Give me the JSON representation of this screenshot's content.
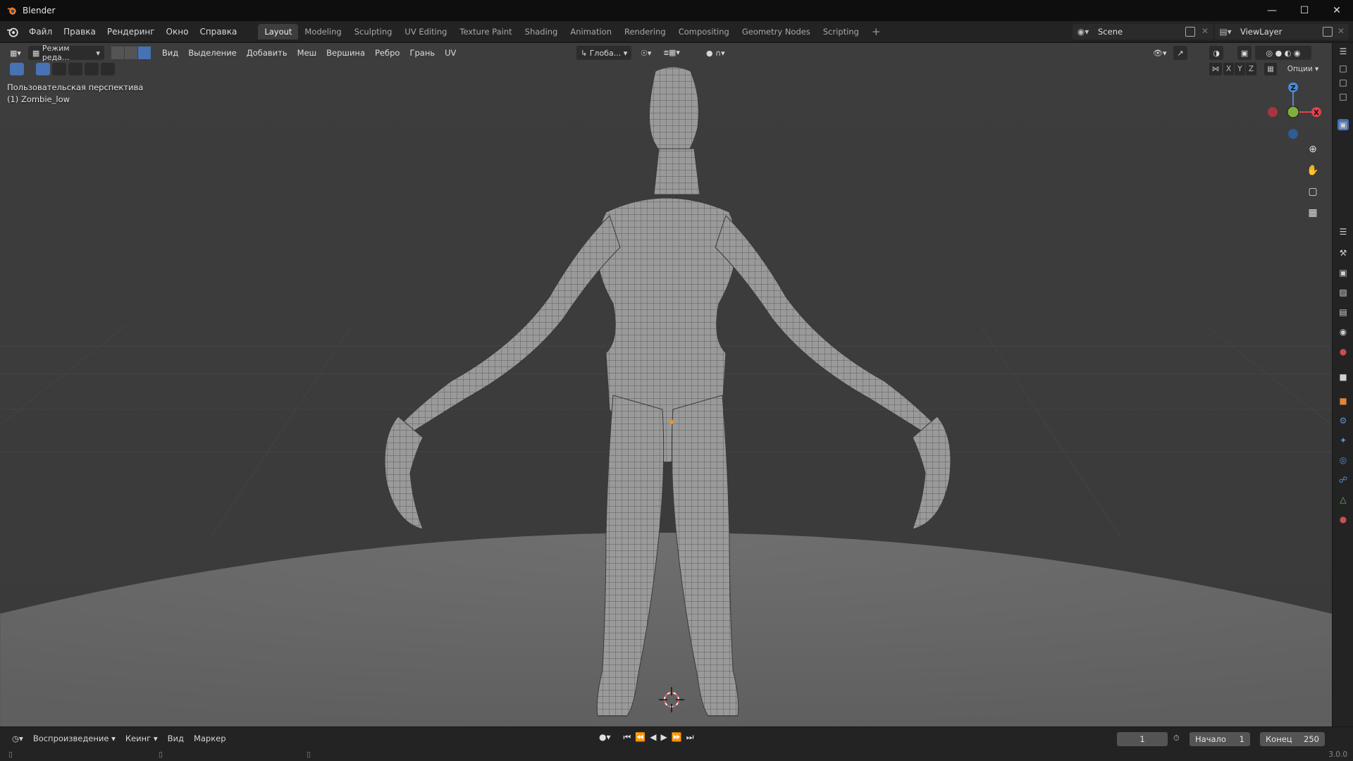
{
  "window": {
    "title": "Blender"
  },
  "menu": {
    "items": [
      "Файл",
      "Правка",
      "Рендеринг",
      "Окно",
      "Справка"
    ]
  },
  "workspaces": {
    "tabs": [
      "Layout",
      "Modeling",
      "Sculpting",
      "UV Editing",
      "Texture Paint",
      "Shading",
      "Animation",
      "Rendering",
      "Compositing",
      "Geometry Nodes",
      "Scripting"
    ],
    "active": "Layout",
    "add": "+"
  },
  "scene": {
    "name": "Scene"
  },
  "view_layer": {
    "name": "ViewLayer"
  },
  "viewport_header": {
    "mode": "Режим реда...",
    "menus": [
      "Вид",
      "Выделение",
      "Добавить",
      "Меш",
      "Вершина",
      "Ребро",
      "Грань",
      "UV"
    ],
    "orientation": "Глоба...",
    "options": "Опции",
    "axes": [
      "X",
      "Y",
      "Z"
    ]
  },
  "viewport": {
    "view_name": "Пользовательская перспектива",
    "object_name": "(1) Zombie_low",
    "gizmo_axes": [
      "Z",
      "X"
    ]
  },
  "timeline": {
    "playback": "Воспроизведение",
    "keying": "Кеинг",
    "view": "Вид",
    "marker": "Маркер",
    "current_frame": "1",
    "start_label": "Начало",
    "start": "1",
    "end_label": "Конец",
    "end": "250"
  },
  "status": {
    "version": "3.0.0"
  },
  "colors": {
    "accent": "#4772b3",
    "axis_x": "#e2424e",
    "axis_y": "#7eae3c",
    "axis_z": "#4a8ad6"
  }
}
